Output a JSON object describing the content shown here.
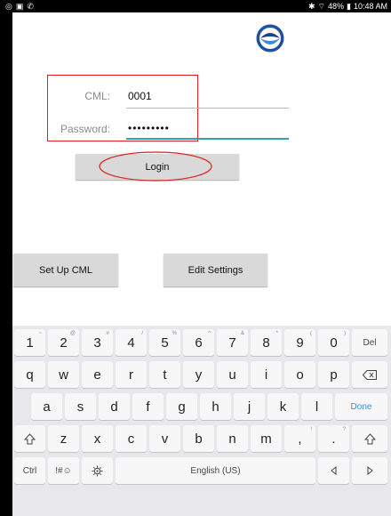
{
  "status_bar": {
    "battery": "48%",
    "time": "10:48 AM"
  },
  "form": {
    "cml_label": "CML:",
    "cml_value": "0001",
    "password_label": "Password:",
    "password_value": "•••••••••"
  },
  "buttons": {
    "login": "Login",
    "setup_cml": "Set Up CML",
    "edit_settings": "Edit Settings"
  },
  "keyboard": {
    "row1": [
      {
        "k": "1",
        "s": "~"
      },
      {
        "k": "2",
        "s": "@"
      },
      {
        "k": "3",
        "s": "#"
      },
      {
        "k": "4",
        "s": "/"
      },
      {
        "k": "5",
        "s": "%"
      },
      {
        "k": "6",
        "s": "^"
      },
      {
        "k": "7",
        "s": "&"
      },
      {
        "k": "8",
        "s": "*"
      },
      {
        "k": "9",
        "s": "("
      },
      {
        "k": "0",
        "s": ")"
      },
      {
        "k": "Del",
        "s": ""
      }
    ],
    "row2": [
      "q",
      "w",
      "e",
      "r",
      "t",
      "y",
      "u",
      "i",
      "o",
      "p"
    ],
    "row3": [
      "a",
      "s",
      "d",
      "f",
      "g",
      "h",
      "j",
      "k",
      "l"
    ],
    "row3_done": "Done",
    "row4": [
      {
        "k": "z",
        "s": ""
      },
      {
        "k": "x",
        "s": ""
      },
      {
        "k": "c",
        "s": ""
      },
      {
        "k": "v",
        "s": ""
      },
      {
        "k": "b",
        "s": ""
      },
      {
        "k": "n",
        "s": ""
      },
      {
        "k": "m",
        "s": ""
      },
      {
        "k": ",",
        "s": "!"
      },
      {
        "k": ".",
        "s": "?"
      }
    ],
    "ctrl": "Ctrl",
    "sym": "!#☺",
    "space": "English (US)"
  },
  "colors": {
    "highlight": "#e02020",
    "accent": "#2aa2b8"
  }
}
